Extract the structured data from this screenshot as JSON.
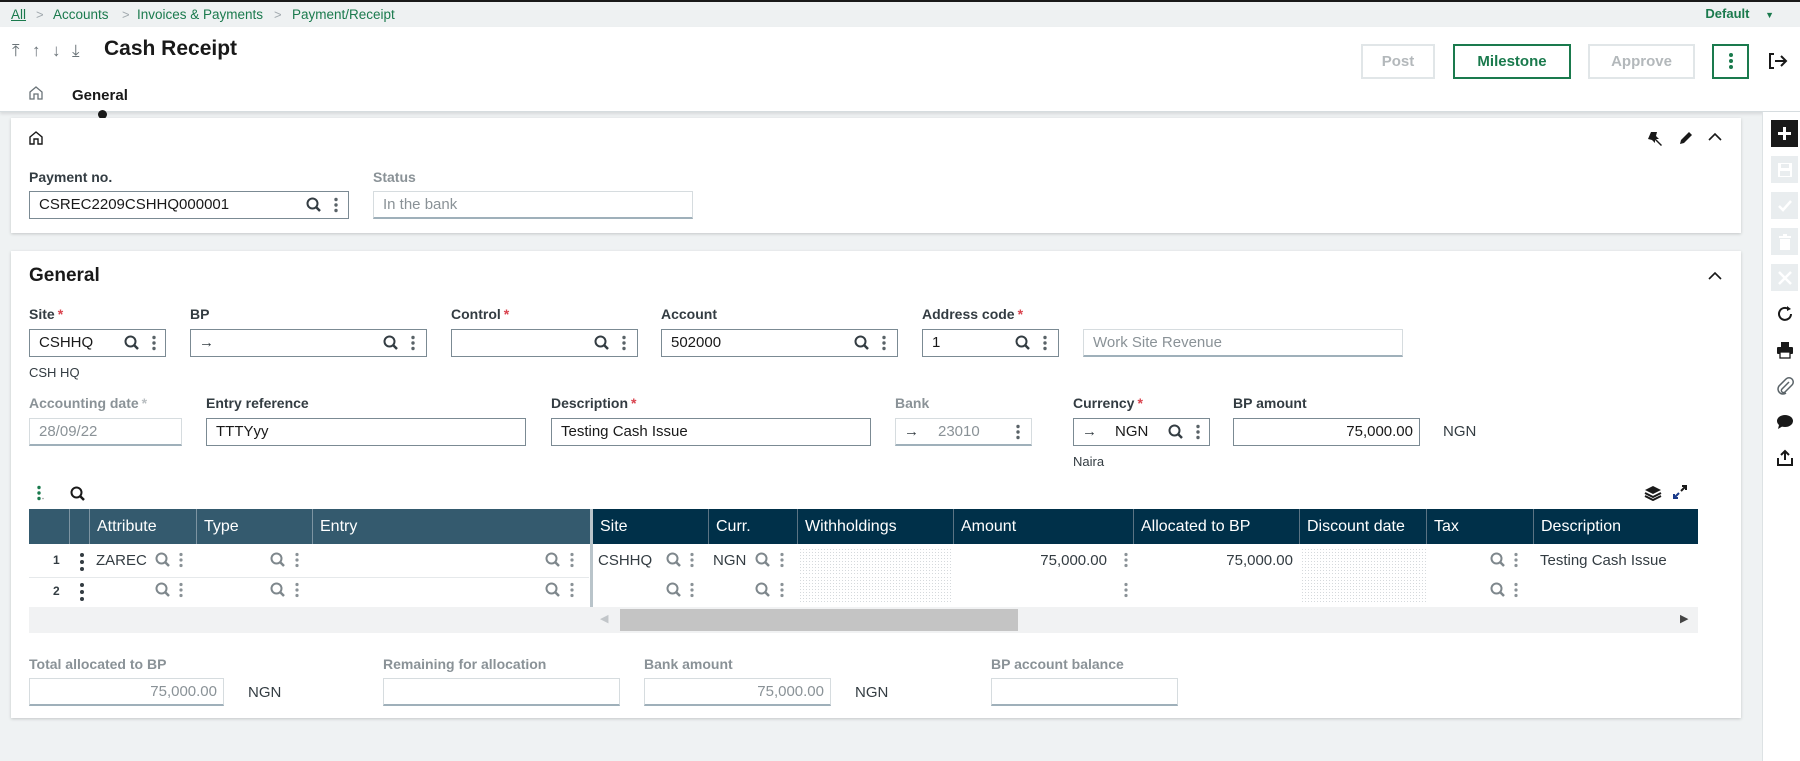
{
  "breadcrumb": {
    "items": [
      "All",
      "Accounts",
      "Invoices & Payments",
      "Payment/Receipt"
    ],
    "profile_selector": "Default"
  },
  "header": {
    "title": "Cash Receipt",
    "nav_icons": [
      "first-record-icon",
      "previous-record-icon",
      "next-record-icon",
      "last-record-icon"
    ],
    "buttons": {
      "post": "Post",
      "milestone": "Milestone",
      "approve": "Approve"
    },
    "tabs": [
      {
        "label": "General",
        "active": true
      }
    ],
    "accent_color": "#1a7a4d"
  },
  "header_card": {
    "payment_no": {
      "label": "Payment no.",
      "value": "CSREC2209CSHHQ000001"
    },
    "status": {
      "label": "Status",
      "value": "In the bank"
    }
  },
  "general": {
    "title": "General",
    "site": {
      "label": "Site",
      "value": "CSHHQ",
      "sub": "CSH HQ"
    },
    "bp": {
      "label": "BP",
      "value": ""
    },
    "control": {
      "label": "Control",
      "value": ""
    },
    "account": {
      "label": "Account",
      "value": "502000"
    },
    "address_code": {
      "label": "Address code",
      "value": "1"
    },
    "address_desc": {
      "value": "Work Site Revenue"
    },
    "accounting_date": {
      "label": "Accounting date",
      "value": "28/09/22"
    },
    "entry_reference": {
      "label": "Entry reference",
      "value": "TTTYyy"
    },
    "description": {
      "label": "Description",
      "value": "Testing Cash Issue"
    },
    "bank": {
      "label": "Bank",
      "value": "23010"
    },
    "currency": {
      "label": "Currency",
      "value": "NGN",
      "sub": "Naira"
    },
    "bp_amount": {
      "label": "BP amount",
      "value": "75,000.00",
      "unit": "NGN"
    }
  },
  "grid": {
    "left_columns": [
      "Attribute",
      "Type",
      "Entry"
    ],
    "right_columns": [
      "Site",
      "Curr.",
      "Withholdings",
      "Amount",
      "Allocated to BP",
      "Discount date",
      "Tax",
      "Description"
    ],
    "rows": [
      {
        "num": "1",
        "attribute": "ZAREC",
        "type": "",
        "entry": "",
        "site": "CSHHQ",
        "curr": "NGN",
        "withholdings": "",
        "amount": "75,000.00",
        "allocated": "75,000.00",
        "discount_date": "",
        "tax": "",
        "description": "Testing Cash Issue"
      },
      {
        "num": "2",
        "attribute": "",
        "type": "",
        "entry": "",
        "site": "",
        "curr": "",
        "withholdings": "",
        "amount": "",
        "allocated": "",
        "discount_date": "",
        "tax": "",
        "description": ""
      }
    ]
  },
  "totals": {
    "total_allocated": {
      "label": "Total allocated to BP",
      "value": "75,000.00",
      "unit": "NGN"
    },
    "remaining": {
      "label": "Remaining for allocation",
      "value": ""
    },
    "bank_amount": {
      "label": "Bank amount",
      "value": "75,000.00",
      "unit": "NGN"
    },
    "bp_balance": {
      "label": "BP account balance",
      "value": ""
    }
  }
}
